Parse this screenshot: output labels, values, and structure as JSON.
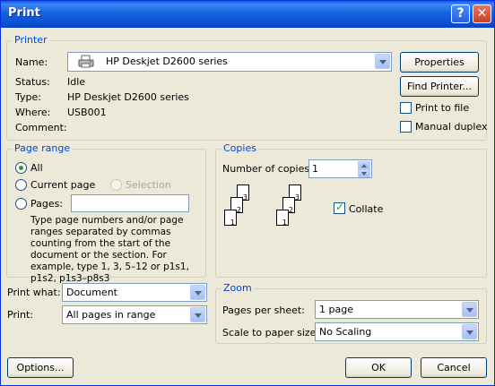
{
  "window": {
    "title": "Print",
    "help_glyph": "?",
    "close_glyph": "✕"
  },
  "printer": {
    "legend": "Printer",
    "name_label": "Name:",
    "name_value": "HP Deskjet D2600 series",
    "status_label": "Status:",
    "status_value": "Idle",
    "type_label": "Type:",
    "type_value": "HP Deskjet D2600 series",
    "where_label": "Where:",
    "where_value": "USB001",
    "comment_label": "Comment:",
    "comment_value": "",
    "properties_label": "Properties",
    "find_printer_label": "Find Printer...",
    "print_to_file_label": "Print to file",
    "manual_duplex_label": "Manual duplex",
    "print_to_file_checked": false,
    "manual_duplex_checked": false
  },
  "page_range": {
    "legend": "Page range",
    "all_label": "All",
    "current_page_label": "Current page",
    "selection_label": "Selection",
    "pages_label": "Pages:",
    "pages_value": "",
    "selected": "All",
    "help_text": "Type page numbers and/or page ranges separated by commas counting from the start of the document or the section. For example, type 1, 3, 5–12 or p1s1, p1s2, p1s3–p8s3"
  },
  "copies": {
    "legend": "Copies",
    "number_label": "Number of copies:",
    "number_value": "1",
    "collate_label": "Collate",
    "collate_checked": true,
    "page_numbers": [
      "3",
      "2",
      "1"
    ]
  },
  "print_what": {
    "label": "Print what:",
    "value": "Document"
  },
  "print": {
    "label": "Print:",
    "value": "All pages in range"
  },
  "zoom": {
    "legend": "Zoom",
    "pages_per_sheet_label": "Pages per sheet:",
    "pages_per_sheet_value": "1 page",
    "scale_label": "Scale to paper size:",
    "scale_value": "No Scaling"
  },
  "footer": {
    "options_label": "Options...",
    "ok_label": "OK",
    "cancel_label": "Cancel"
  }
}
